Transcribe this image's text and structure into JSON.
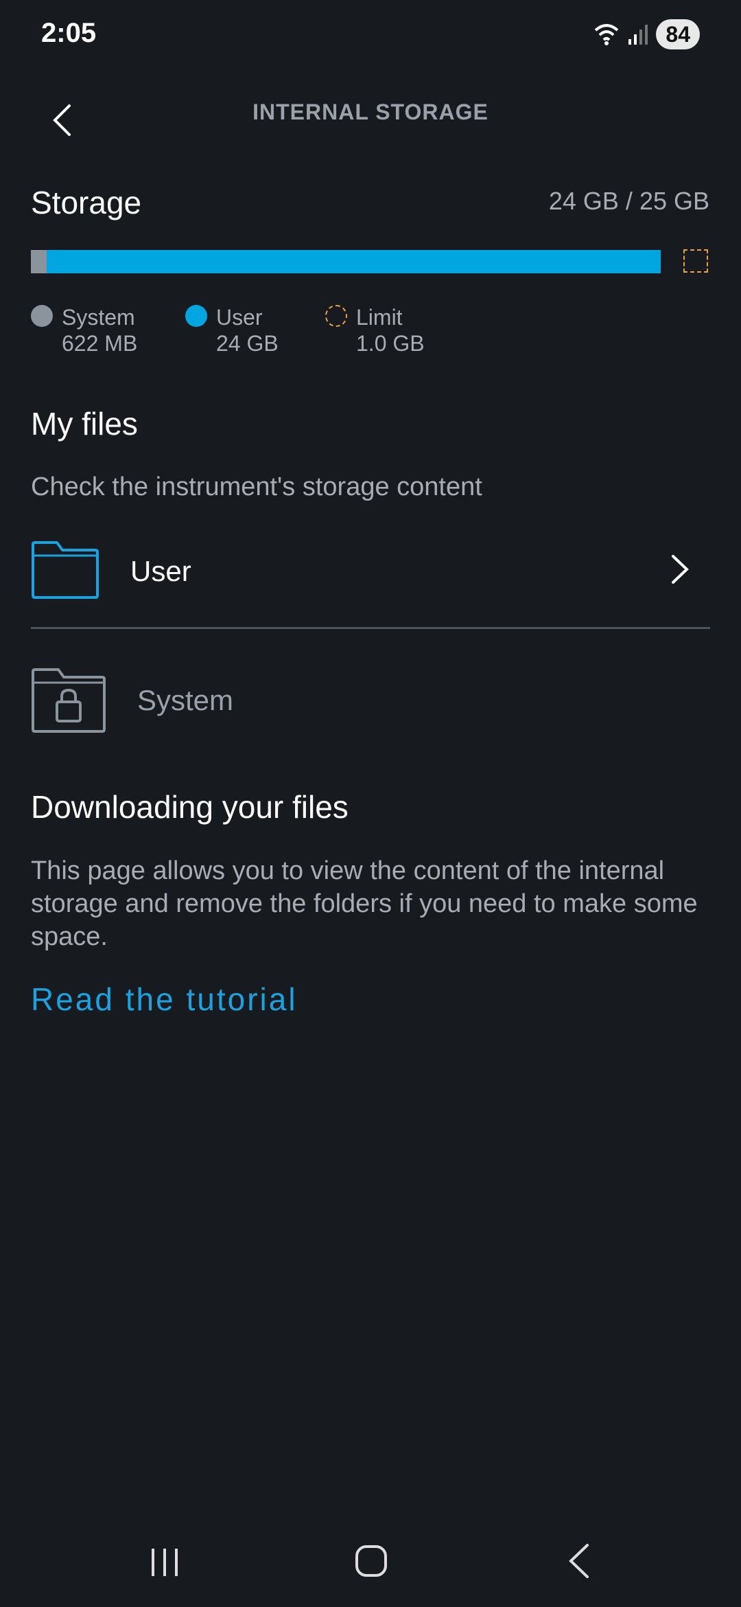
{
  "status_bar": {
    "time": "2:05",
    "battery": "84",
    "icons": [
      "wifi-icon",
      "signal-icon"
    ]
  },
  "header": {
    "title": "INTERNAL STORAGE",
    "back_icon": "chevron-left-icon"
  },
  "storage": {
    "title": "Storage",
    "total": "24 GB / 25 GB",
    "bar": {
      "system_fraction": 0.024,
      "user_fraction": 0.936,
      "limit_fraction": 0.04
    },
    "legend": [
      {
        "label": "System",
        "value": "622 MB",
        "color": "#8b939c"
      },
      {
        "label": "User",
        "value": "24 GB",
        "color": "#00a6e0"
      },
      {
        "label": "Limit",
        "value": "1.0 GB",
        "color": "#e8a33a"
      }
    ]
  },
  "my_files": {
    "title": "My files",
    "subtitle": "Check the instrument's storage content",
    "folders": [
      {
        "label": "User",
        "icon": "folder-icon",
        "locked": false
      },
      {
        "label": "System",
        "icon": "locked-folder-icon",
        "locked": true
      }
    ]
  },
  "downloading": {
    "title": "Downloading your files",
    "body": "This page allows you to view the content of the internal storage and remove the folders if you need to make some space.",
    "link": "Read the tutorial"
  },
  "colors": {
    "background": "#171a1f",
    "accent": "#00a6e0",
    "muted": "#a8adb5",
    "limit": "#e8a33a"
  }
}
